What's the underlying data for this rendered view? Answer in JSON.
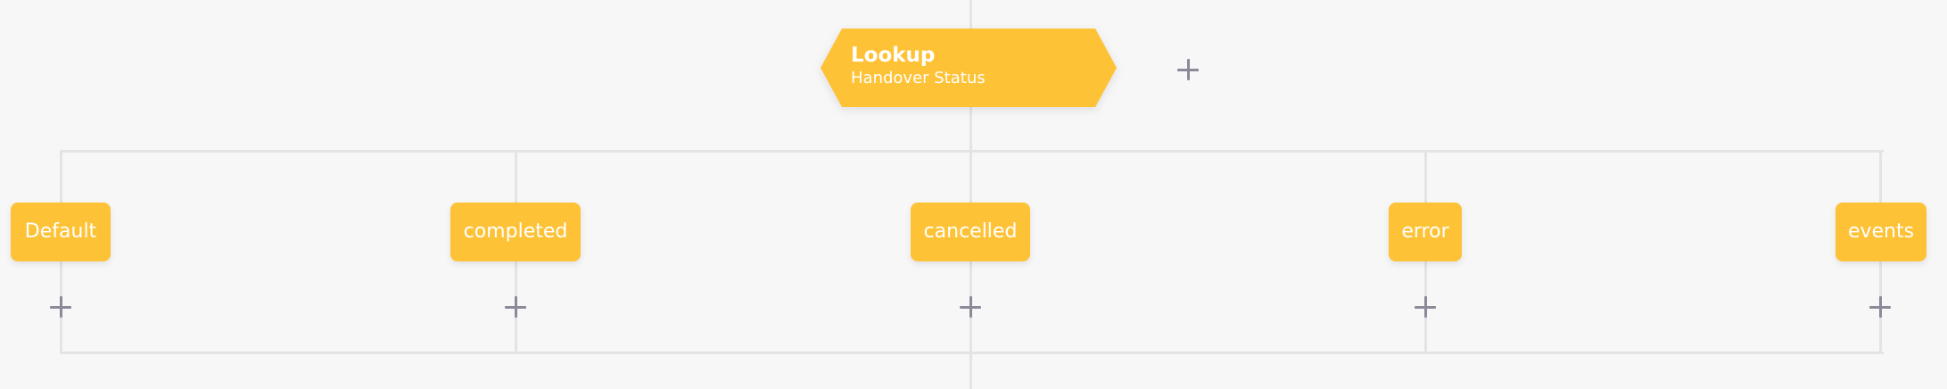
{
  "lookup_node": {
    "title": "Lookup",
    "subtitle": "Handover Status"
  },
  "branches": [
    {
      "label": "Default"
    },
    {
      "label": "completed"
    },
    {
      "label": "cancelled"
    },
    {
      "label": "error"
    },
    {
      "label": "events"
    }
  ],
  "icons": {
    "add": "plus-icon"
  },
  "colors": {
    "node_fill": "#fec236",
    "node_text": "#ffffff",
    "connector": "#e4e4e4",
    "add_icon": "#8a8a99",
    "background": "#f7f7f7"
  }
}
